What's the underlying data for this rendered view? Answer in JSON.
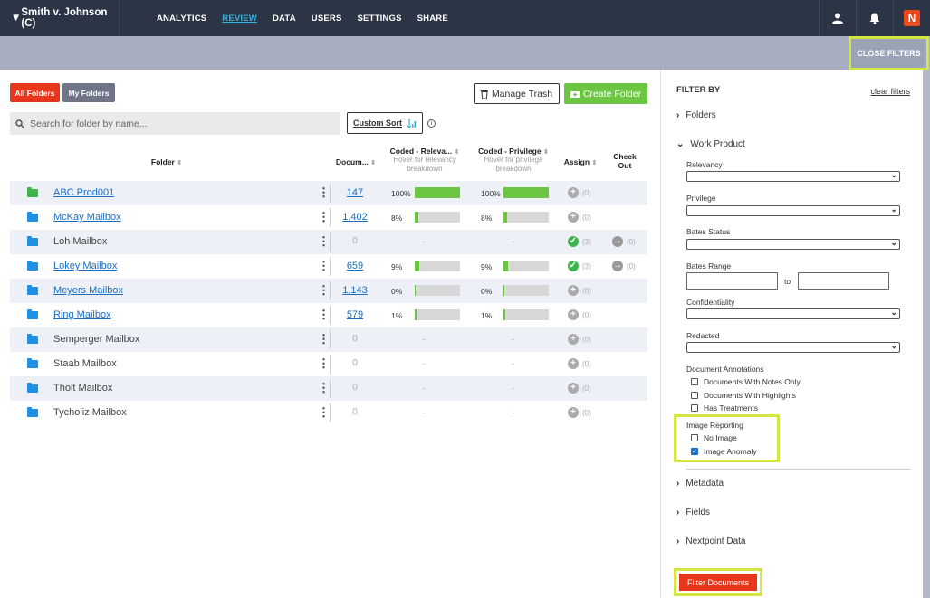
{
  "topnav": {
    "case_title": "Smith v. Johnson (C)",
    "caret": "▼",
    "links": [
      "ANALYTICS",
      "REVIEW",
      "DATA",
      "USERS",
      "SETTINGS",
      "SHARE"
    ],
    "active_link": "REVIEW",
    "brand_letter": "N"
  },
  "subbar": {
    "close_filters": "CLOSE FILTERS"
  },
  "toolbar": {
    "all_folders": "All Folders",
    "my_folders": "My Folders",
    "manage_trash": "Manage Trash",
    "create_folder": "Create Folder",
    "search_placeholder": "Search for folder by name...",
    "custom_sort": "Custom Sort"
  },
  "table": {
    "headers": {
      "folder": "Folder",
      "documents": "Docum...",
      "coded_relevancy": "Coded - Releva...",
      "coded_relevancy_sub": "Hover for relevancy breakdown",
      "coded_privilege": "Coded - Privilege",
      "coded_privilege_sub": "Hover for privilege breakdown",
      "assign": "Assign",
      "check_out": "Check Out"
    },
    "rows": [
      {
        "name": "ABC Prod001",
        "link": true,
        "folder_color": "#3cb54a",
        "docs": "147",
        "rel_pct": "100%",
        "rel_val": 100,
        "priv_pct": "100%",
        "priv_val": 100,
        "assign": "plus",
        "assign_count": "(0)",
        "checkout": null,
        "checkout_count": ""
      },
      {
        "name": "McKay Mailbox",
        "link": true,
        "folder_color": "#1e90e6",
        "docs": "1,402",
        "rel_pct": "8%",
        "rel_val": 8,
        "priv_pct": "8%",
        "priv_val": 8,
        "assign": "plus",
        "assign_count": "(0)",
        "checkout": null,
        "checkout_count": ""
      },
      {
        "name": "Loh Mailbox",
        "link": false,
        "folder_color": "#1e90e6",
        "docs": "0",
        "rel_pct": "-",
        "rel_val": null,
        "priv_pct": "-",
        "priv_val": null,
        "assign": "check",
        "assign_count": "(3)",
        "checkout": "arrow",
        "checkout_count": "(0)"
      },
      {
        "name": "Lokey Mailbox",
        "link": true,
        "folder_color": "#1e90e6",
        "docs": "659",
        "rel_pct": "9%",
        "rel_val": 9,
        "priv_pct": "9%",
        "priv_val": 9,
        "assign": "check",
        "assign_count": "(3)",
        "checkout": "arrow",
        "checkout_count": "(0)"
      },
      {
        "name": "Meyers Mailbox",
        "link": true,
        "folder_color": "#1e90e6",
        "docs": "1,143",
        "rel_pct": "0%",
        "rel_val": 0,
        "priv_pct": "0%",
        "priv_val": 0,
        "assign": "plus",
        "assign_count": "(0)",
        "checkout": null,
        "checkout_count": ""
      },
      {
        "name": "Ring Mailbox",
        "link": true,
        "folder_color": "#1e90e6",
        "docs": "579",
        "rel_pct": "1%",
        "rel_val": 1,
        "priv_pct": "1%",
        "priv_val": 1,
        "assign": "plus",
        "assign_count": "(0)",
        "checkout": null,
        "checkout_count": ""
      },
      {
        "name": "Semperger Mailbox",
        "link": false,
        "folder_color": "#1e90e6",
        "docs": "0",
        "rel_pct": "-",
        "rel_val": null,
        "priv_pct": "-",
        "priv_val": null,
        "assign": "plus",
        "assign_count": "(0)",
        "checkout": null,
        "checkout_count": ""
      },
      {
        "name": "Staab Mailbox",
        "link": false,
        "folder_color": "#1e90e6",
        "docs": "0",
        "rel_pct": "-",
        "rel_val": null,
        "priv_pct": "-",
        "priv_val": null,
        "assign": "plus",
        "assign_count": "(0)",
        "checkout": null,
        "checkout_count": ""
      },
      {
        "name": "Tholt Mailbox",
        "link": false,
        "folder_color": "#1e90e6",
        "docs": "0",
        "rel_pct": "-",
        "rel_val": null,
        "priv_pct": "-",
        "priv_val": null,
        "assign": "plus",
        "assign_count": "(0)",
        "checkout": null,
        "checkout_count": ""
      },
      {
        "name": "Tycholiz Mailbox",
        "link": false,
        "folder_color": "#1e90e6",
        "docs": "0",
        "rel_pct": "-",
        "rel_val": null,
        "priv_pct": "-",
        "priv_val": null,
        "assign": "plus",
        "assign_count": "(0)",
        "checkout": null,
        "checkout_count": ""
      }
    ]
  },
  "filter": {
    "title": "FILTER BY",
    "clear": "clear filters",
    "folders": "Folders",
    "work_product": "Work Product",
    "relevancy": "Relevancy",
    "privilege": "Privilege",
    "bates_status": "Bates Status",
    "bates_range": "Bates Range",
    "to": "to",
    "confidentiality": "Confidentiality",
    "redacted": "Redacted",
    "doc_annotations": "Document Annotations",
    "ann_notes": "Documents With Notes Only",
    "ann_highlights": "Documents With Highlights",
    "ann_treatments": "Has Treatments",
    "image_reporting": "Image Reporting",
    "no_image": "No Image",
    "image_anomaly": "Image Anomaly",
    "image_anomaly_checked": true,
    "metadata": "Metadata",
    "fields": "Fields",
    "nextpoint_data": "Nextpoint Data",
    "filter_documents": "Filter Documents"
  },
  "colors": {
    "nav_bg": "#2c3545",
    "accent_red": "#e8361c",
    "green": "#6cc644",
    "link_blue": "#1a6fc4",
    "highlight": "#d5e640"
  }
}
